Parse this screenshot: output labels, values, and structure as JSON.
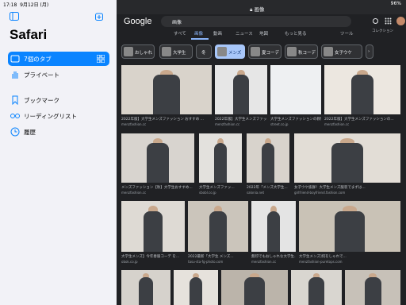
{
  "status": {
    "time": "17:18",
    "date": "9月12日 (月)",
    "battery": "96%"
  },
  "sidebar": {
    "title": "Safari",
    "items": [
      {
        "label": "7個のタブ",
        "icon": "tabs-icon"
      },
      {
        "label": "プライベート",
        "icon": "hand-icon"
      },
      {
        "label": "ブックマーク",
        "icon": "bookmark-icon"
      },
      {
        "label": "リーディングリスト",
        "icon": "glasses-icon"
      },
      {
        "label": "履歴",
        "icon": "clock-icon"
      }
    ]
  },
  "browser": {
    "url": "画像",
    "logo": "Google",
    "query": "画像",
    "tabs": [
      {
        "label": "すべて"
      },
      {
        "label": "画像"
      },
      {
        "label": "動画"
      },
      {
        "label": "ニュース"
      },
      {
        "label": "地図"
      },
      {
        "label": "もっと見る"
      },
      {
        "label": "ツール"
      }
    ],
    "collection": "コレクション",
    "chips": [
      {
        "label": "おしゃれ"
      },
      {
        "label": "大学生"
      },
      {
        "label": "冬"
      },
      {
        "label": "メンズ"
      },
      {
        "label": "夏コーデ"
      },
      {
        "label": "秋コーデ"
      },
      {
        "label": "女子ウケ"
      }
    ],
    "results": [
      {
        "cap": "2022年版】大学生メンズファッション おすすめ ...",
        "src": "menzfashion.cc"
      },
      {
        "cap": "2022年版】大学生メンズファッ...",
        "src": "menzfashion.cc"
      },
      {
        "cap": "大学生メンズファッションの教科書",
        "src": "street.co.jp"
      },
      {
        "cap": "2022年版】大学生メンズファッションの...",
        "src": "menzfashion.cc"
      },
      {
        "cap": "メンズファッション【秋】大学生おすすめ...",
        "src": "menzfashion.cc"
      },
      {
        "cap": "大学生メンズファッ...",
        "src": "sbobl.co.jp"
      },
      {
        "cap": "2022年「メンズ大学生...",
        "src": "salonia.net"
      },
      {
        "cap": "女子ウケ抜群！大学生メンズ服装でまずは...",
        "src": "girlfriend-boyfriend.fashion.com"
      },
      {
        "cap": "大学生メンズ】今年春服コーデ を...",
        "src": "obok.co.jp"
      },
      {
        "cap": "2022最新「大学生 メンズ...",
        "src": "tasu-sta-fg-photo.com"
      },
      {
        "cap": "無印でもおしゃれな大学生...",
        "src": "menzfashion.cc"
      },
      {
        "cap": "大学生メンズ]何をしゃれで...",
        "src": "menzfashion-puretops.com"
      }
    ]
  }
}
